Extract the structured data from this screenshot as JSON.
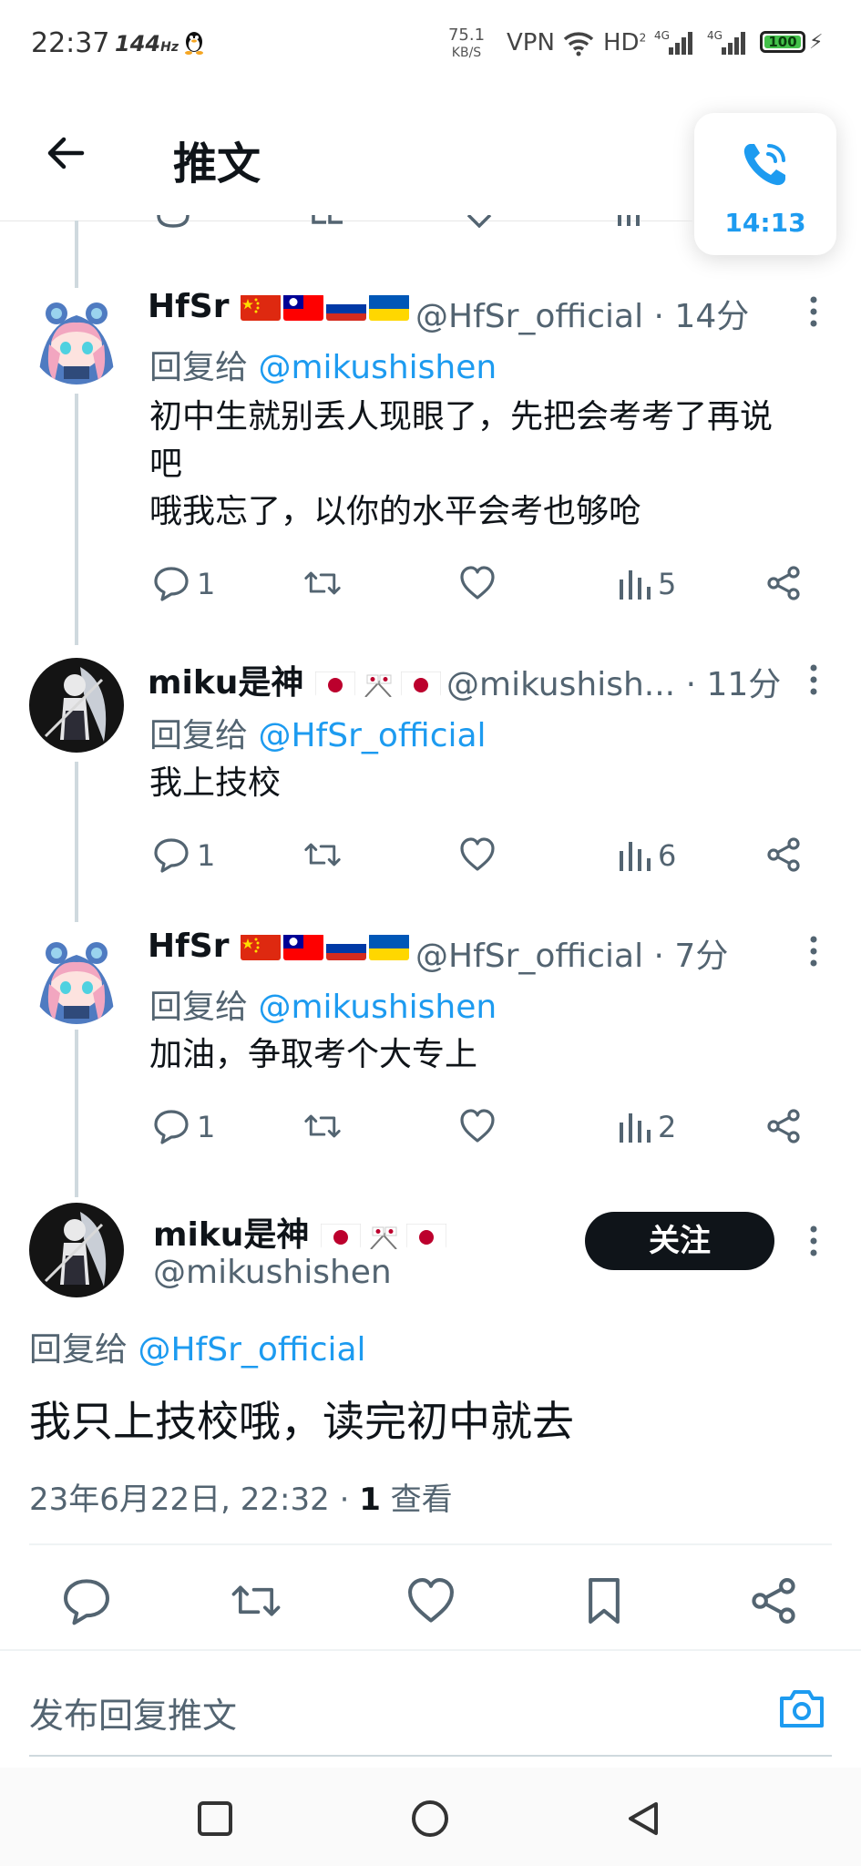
{
  "status_bar": {
    "time": "22:37",
    "refresh_rate": "144",
    "refresh_unit": "Hz",
    "speed_value": "75.1",
    "speed_unit": "KB/S",
    "vpn": "VPN",
    "hd": "HD",
    "hd_sub": "2",
    "net1": "4G",
    "net2": "4G",
    "battery": "100"
  },
  "header": {
    "title": "推文",
    "call_time": "14:13"
  },
  "replies": [
    {
      "display_name": "HfSr",
      "flags": [
        "china-flag",
        "taiwan-flag",
        "russia-flag",
        "ukraine-flag"
      ],
      "handle": "@HfSr_official",
      "time": "· 14分",
      "reply_prefix": "回复给",
      "reply_to": "@mikushishen",
      "text_line1": "初中生就别丢人现眼了，先把会考考了再说",
      "text_line2": "吧",
      "text_line3": "哦我忘了，以你的水平会考也够呛",
      "replies": "1",
      "views": "5"
    },
    {
      "display_name": "miku是神",
      "flags": [
        "japan-flag",
        "crossed-japan-flags",
        "japan-flag"
      ],
      "handle": "@mikushish...",
      "time": "· 11分",
      "reply_prefix": "回复给",
      "reply_to": "@HfSr_official",
      "text_line1": "我上技校",
      "replies": "1",
      "views": "6"
    },
    {
      "display_name": "HfSr",
      "flags": [
        "china-flag",
        "taiwan-flag",
        "russia-flag",
        "ukraine-flag"
      ],
      "handle": "@HfSr_official",
      "time": "· 7分",
      "reply_prefix": "回复给",
      "reply_to": "@mikushishen",
      "text_line1": "加油，争取考个大专上",
      "replies": "1",
      "views": "2"
    }
  ],
  "main_tweet": {
    "display_name": "miku是神",
    "handle": "@mikushishen",
    "follow_label": "关注",
    "reply_prefix": "回复给",
    "reply_to": "@HfSr_official",
    "text": "我只上技校哦，读完初中就去",
    "date": "23年6月22日, 22:32 · ",
    "views_count": "1",
    "views_label": " 查看"
  },
  "composer": {
    "placeholder": "发布回复推文"
  },
  "colors": {
    "accent": "#1d9bf0",
    "text": "#0f1419",
    "muted": "#536471",
    "thread_line": "#cfd9de"
  }
}
